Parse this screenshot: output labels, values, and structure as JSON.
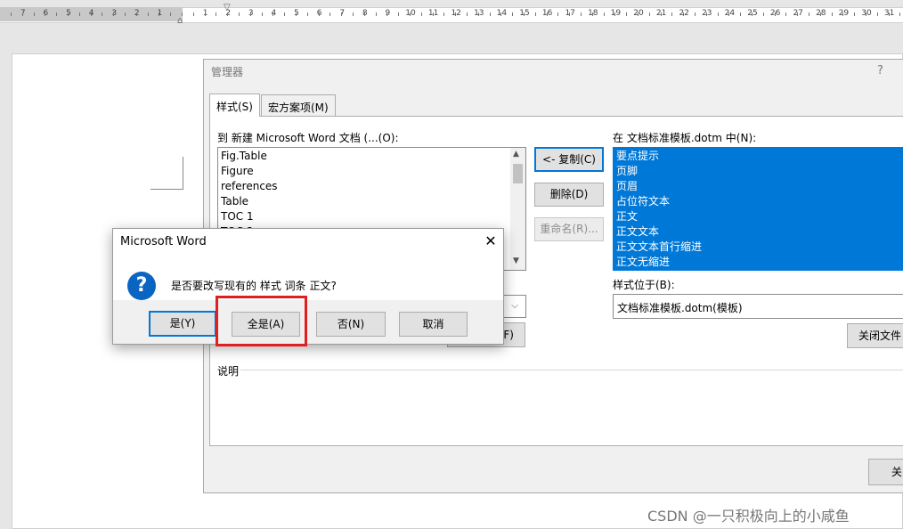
{
  "ruler": {
    "left_numbers": [
      "7",
      "6",
      "5",
      "4",
      "3",
      "2",
      "1"
    ],
    "right_numbers": [
      "1",
      "2",
      "3",
      "4",
      "5",
      "6",
      "7",
      "8",
      "9",
      "10",
      "11",
      "12",
      "13",
      "14",
      "15",
      "16",
      "17",
      "18",
      "19",
      "20",
      "21",
      "22",
      "23",
      "24",
      "25",
      "26",
      "27",
      "28",
      "29",
      "30",
      "31"
    ]
  },
  "organizer": {
    "title": "管理器",
    "help": "?",
    "tabs": [
      "样式(S)",
      "宏方案项(M)"
    ],
    "left_label": "到 新建 Microsoft Word 文档 (...(O):",
    "left_items": [
      "Fig.Table",
      "Figure",
      "references",
      "Table",
      "TOC 1",
      "TOC 2"
    ],
    "right_label": "在 文档标准模板.dotm 中(N):",
    "right_items": [
      "要点提示",
      "页脚",
      "页眉",
      "占位符文本",
      "正文",
      "正文文本",
      "正文文本首行缩进",
      "正文无缩进"
    ],
    "buttons": {
      "copy": "<- 复制(C)",
      "delete": "删除(D)",
      "rename": "重命名(R)...",
      "left_close_partial": "F)",
      "close_file": "关闭文件",
      "close": "关"
    },
    "styles_in_label": "样式位于(B):",
    "styles_in_value": "文档标准模板.dotm(模板)",
    "description_label": "说明"
  },
  "msgbox": {
    "title": "Microsoft Word",
    "close": "✕",
    "message": "是否要改写现有的 样式 词条 正文?",
    "buttons": [
      "是(Y)",
      "全是(A)",
      "否(N)",
      "取消"
    ]
  },
  "watermark": "CSDN @一只积极向上的小咸鱼",
  "colors": {
    "selection": "#0078d7",
    "highlight": "#e02020",
    "icon": "#0a64c2"
  }
}
